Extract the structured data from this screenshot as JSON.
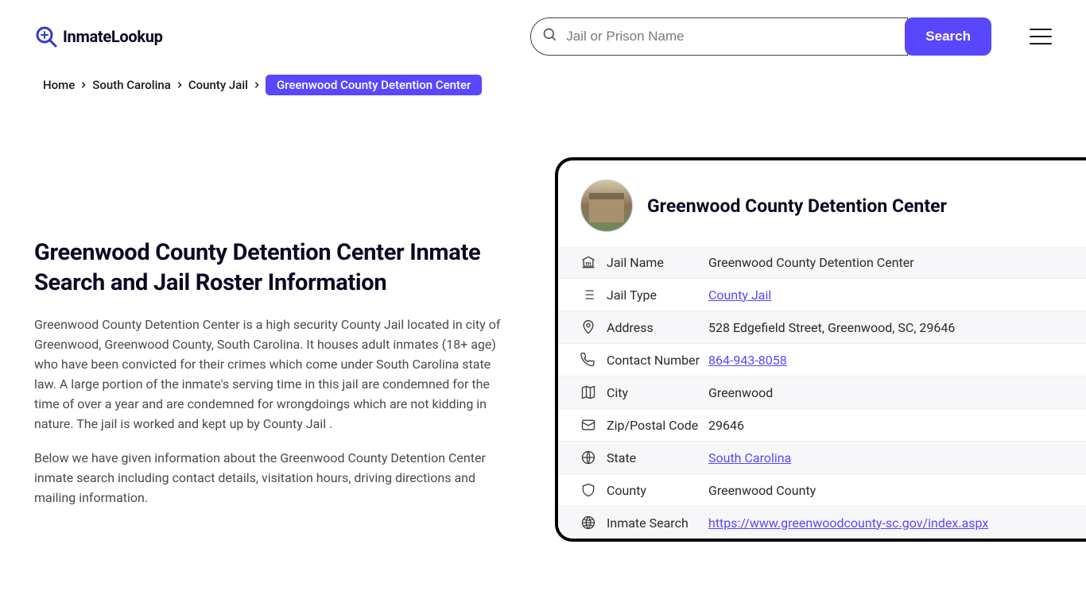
{
  "logo": {
    "text": "InmateLookup"
  },
  "search": {
    "placeholder": "Jail or Prison Name",
    "button": "Search"
  },
  "breadcrumb": {
    "items": [
      "Home",
      "South Carolina",
      "County Jail"
    ],
    "current": "Greenwood County Detention Center"
  },
  "page": {
    "title": "Greenwood County Detention Center Inmate Search and Jail Roster Information",
    "paragraph1": "Greenwood County Detention Center is a high security County Jail located in city of Greenwood, Greenwood County, South Carolina. It houses adult inmates (18+ age) who have been convicted for their crimes which come under South Carolina state law. A large portion of the inmate's serving time in this jail are condemned for the time of over a year and are condemned for wrongdoings which are not kidding in nature. The jail is worked and kept up by County Jail .",
    "paragraph2": "Below we have given information about the Greenwood County Detention Center inmate search including contact details, visitation hours, driving directions and mailing information."
  },
  "card": {
    "title": "Greenwood County Detention Center",
    "rows": [
      {
        "icon": "bank",
        "label": "Jail Name",
        "value": "Greenwood County Detention Center",
        "link": false
      },
      {
        "icon": "list",
        "label": "Jail Type",
        "value": "County Jail",
        "link": true
      },
      {
        "icon": "pin",
        "label": "Address",
        "value": "528 Edgefield Street, Greenwood, SC, 29646",
        "link": false
      },
      {
        "icon": "phone",
        "label": "Contact Number",
        "value": "864-943-8058",
        "link": true
      },
      {
        "icon": "map",
        "label": "City",
        "value": "Greenwood",
        "link": false
      },
      {
        "icon": "envelope",
        "label": "Zip/Postal Code",
        "value": "29646",
        "link": false
      },
      {
        "icon": "globe",
        "label": "State",
        "value": "South Carolina",
        "link": true
      },
      {
        "icon": "shield",
        "label": "County",
        "value": "Greenwood County",
        "link": false
      },
      {
        "icon": "web",
        "label": "Inmate Search",
        "value": "https://www.greenwoodcounty-sc.gov/index.aspx",
        "link": true
      }
    ]
  }
}
